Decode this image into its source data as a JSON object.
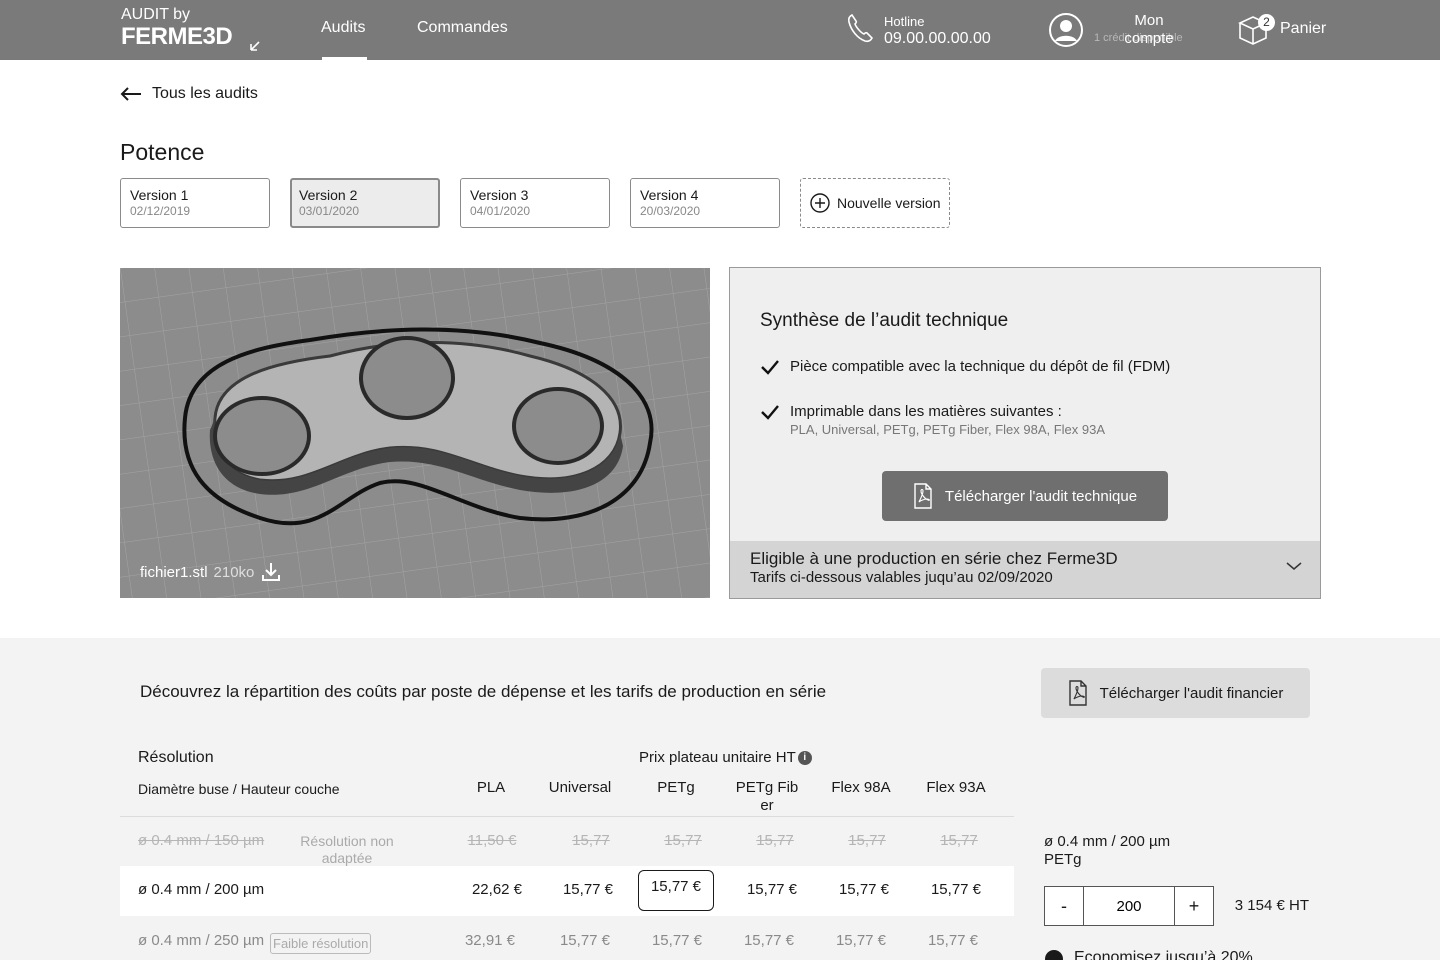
{
  "header": {
    "logo_top": "AUDIT by",
    "logo_main": "FERME3D",
    "tabs": [
      {
        "label": "Audits"
      },
      {
        "label": "Commandes"
      }
    ],
    "hotline_label": "Hotline",
    "hotline_number": "09.00.00.00.00",
    "account_label": "Mon compte",
    "account_sub": "1 crédit disponible",
    "cart_count": "2",
    "cart_label": "Panier"
  },
  "back_link": "Tous les audits",
  "title": "Potence",
  "versions": [
    {
      "name": "Version 1",
      "date": "02/12/2019"
    },
    {
      "name": "Version 2",
      "date": "03/01/2020"
    },
    {
      "name": "Version 3",
      "date": "04/01/2020"
    },
    {
      "name": "Version 4",
      "date": "20/03/2020"
    }
  ],
  "new_version_label": "Nouvelle version",
  "preview": {
    "file_name": "fichier1.stl",
    "file_size": "210ko"
  },
  "synthesis": {
    "title": "Synthèse de l’audit technique",
    "check1": "Pièce compatible avec la technique du dépôt de fil (FDM)",
    "check2": "Imprimable dans les matières suivantes :",
    "check2_sub": "PLA, Universal, PETg, PETg Fiber, Flex 98A, Flex 93A",
    "download_label": "Télécharger l'audit technique",
    "eligible_title": "Eligible à une production en série chez Ferme3D",
    "eligible_sub": "Tarifs ci-dessous valables juqu’au 02/09/2020"
  },
  "costs": {
    "intro": "Découvrez la répartition des coûts par poste de dépense et les tarifs de production en série",
    "download_label": "Télécharger l'audit financier",
    "resolution_header": "Résolution",
    "price_header": "Prix plateau unitaire HT",
    "info_glyph": "i",
    "subheader": "Diamètre buse / Hauteur couche",
    "materials": [
      "PLA",
      "Universal",
      "PETg",
      "PETg Fiber",
      "Flex 98A",
      "Flex 93A"
    ],
    "rows": [
      {
        "label": "ø 0.4 mm / 150 µm",
        "note": "Résolution non adaptée",
        "prices": [
          "11,50 €",
          "15,77",
          "15,77",
          "15,77",
          "15,77",
          "15,77"
        ]
      },
      {
        "label": "ø 0.4 mm / 200 µm",
        "prices": [
          "22,62 €",
          "15,77 €",
          "15,77 €",
          "15,77 €",
          "15,77 €",
          "15,77 €"
        ]
      },
      {
        "label": "ø 0.4 mm / 250 µm",
        "note": "Faible résolution",
        "prices": [
          "32,91 €",
          "15,77 €",
          "15,77 €",
          "15,77 €",
          "15,77 €",
          "15,77 €"
        ]
      }
    ]
  },
  "order": {
    "selection_line1": "ø 0.4 mm / 200 µm",
    "selection_line2": "PETg",
    "minus": "-",
    "plus": "+",
    "quantity": "200",
    "total": "3 154 € HT",
    "savings": "Economisez jusqu’à 20%"
  }
}
